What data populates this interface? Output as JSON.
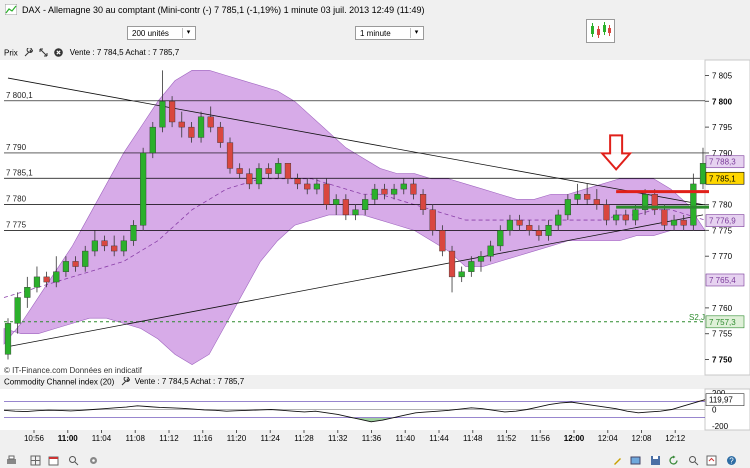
{
  "window": {
    "title": "DAX - Allemagne 30 au comptant (Mini-contr (-)   7 785,1 (-1,19%)    1 minute  03 juil. 2013 12:49 (11:49)"
  },
  "toolbar": {
    "units_select": "200 unités",
    "timeframe_select": "1 minute"
  },
  "price_pane": {
    "label": "Prix",
    "quote": "Vente : 7 784,5 Achat : 7 785,7",
    "footer": "© IT-Finance.com  Données en indicatif",
    "s2_label": "S2,J",
    "left_labels": [
      {
        "text": "7 800,1",
        "price": 7800.1
      },
      {
        "text": "7 790",
        "price": 7790
      },
      {
        "text": "7 785,1",
        "price": 7785.1
      },
      {
        "text": "7 780",
        "price": 7780
      },
      {
        "text": "7 775",
        "price": 7775
      }
    ],
    "axis_ticks": [
      {
        "text": "7 805",
        "value": 7805,
        "bold": false
      },
      {
        "text": "7 800",
        "value": 7800,
        "bold": true
      },
      {
        "text": "7 795",
        "value": 7795,
        "bold": false
      },
      {
        "text": "7 790",
        "value": 7790,
        "bold": false
      },
      {
        "text": "7 780",
        "value": 7780,
        "bold": false
      },
      {
        "text": "7 775",
        "value": 7775,
        "bold": false
      },
      {
        "text": "7 770",
        "value": 7770,
        "bold": false
      },
      {
        "text": "7 760",
        "value": 7760,
        "bold": false
      },
      {
        "text": "7 755",
        "value": 7755,
        "bold": false
      },
      {
        "text": "7 750",
        "value": 7750,
        "bold": true
      }
    ],
    "axis_tags": [
      {
        "text": "7 788,3",
        "value": 7788.3,
        "fill": "#e6d2f0",
        "color": "#7a3a9a"
      },
      {
        "text": "7 785,1",
        "value": 7785.1,
        "fill": "#ffd700",
        "color": "#000000"
      },
      {
        "text": "7 776,9",
        "value": 7776.9,
        "fill": "#e6d2f0",
        "color": "#7a3a9a"
      },
      {
        "text": "7 765,4",
        "value": 7765.4,
        "fill": "#e6d2f0",
        "color": "#7a3a9a"
      },
      {
        "text": "7 757,3",
        "value": 7757.3,
        "fill": "#dff0d8",
        "color": "#2e8b2e"
      }
    ]
  },
  "cci_pane": {
    "label": "Commodity Channel index (20)",
    "quote": "Vente : 7 784,5 Achat : 7 785,7",
    "axis_ticks": [
      {
        "text": "200",
        "value": 200
      },
      {
        "text": "100",
        "value": 100
      },
      {
        "text": "0",
        "value": 0
      },
      {
        "text": "-200",
        "value": -200
      }
    ],
    "current_tag": {
      "text": "119,97",
      "value": 119.97
    }
  },
  "time_axis": [
    {
      "text": "10:56",
      "bold": false
    },
    {
      "text": "11:00",
      "bold": true
    },
    {
      "text": "11:04",
      "bold": false
    },
    {
      "text": "11:08",
      "bold": false
    },
    {
      "text": "11:12",
      "bold": false
    },
    {
      "text": "11:16",
      "bold": false
    },
    {
      "text": "11:20",
      "bold": false
    },
    {
      "text": "11:24",
      "bold": false
    },
    {
      "text": "11:28",
      "bold": false
    },
    {
      "text": "11:32",
      "bold": false
    },
    {
      "text": "11:36",
      "bold": false
    },
    {
      "text": "11:40",
      "bold": false
    },
    {
      "text": "11:44",
      "bold": false
    },
    {
      "text": "11:48",
      "bold": false
    },
    {
      "text": "11:52",
      "bold": false
    },
    {
      "text": "11:56",
      "bold": false
    },
    {
      "text": "12:00",
      "bold": true
    },
    {
      "text": "12:04",
      "bold": false
    },
    {
      "text": "12:08",
      "bold": false
    },
    {
      "text": "12:12",
      "bold": false
    }
  ],
  "colors": {
    "up": "#2bb02b",
    "down": "#d9473f",
    "band": "#c98fe0",
    "support": "#2e8b2e",
    "arrow": "#e0201a"
  },
  "chart_data": [
    {
      "type": "candlestick",
      "title": "DAX - Allemagne 30 au comptant (Mini-contr (-)",
      "interval": "1 minute",
      "ylim": [
        7747,
        7808
      ],
      "series_ohlc": [
        [
          7751,
          7758,
          7750,
          7757
        ],
        [
          7757,
          7763,
          7755,
          7762
        ],
        [
          7762,
          7766,
          7760,
          7764
        ],
        [
          7764,
          7768,
          7763,
          7766
        ],
        [
          7766,
          7767,
          7764,
          7765
        ],
        [
          7765,
          7770,
          7764,
          7767
        ],
        [
          7767,
          7770,
          7766,
          7769
        ],
        [
          7769,
          7770,
          7767,
          7768
        ],
        [
          7768,
          7772,
          7767,
          7771
        ],
        [
          7771,
          7775,
          7770,
          7773
        ],
        [
          7773,
          7774,
          7771,
          7772
        ],
        [
          7772,
          7774,
          7770,
          7771
        ],
        [
          7771,
          7774,
          7770,
          7773
        ],
        [
          7773,
          7777,
          7772,
          7776
        ],
        [
          7776,
          7791,
          7775,
          7790
        ],
        [
          7790,
          7796,
          7789,
          7795
        ],
        [
          7795,
          7806,
          7794,
          7800
        ],
        [
          7800,
          7801,
          7795,
          7796
        ],
        [
          7796,
          7798,
          7793,
          7795
        ],
        [
          7795,
          7796,
          7792,
          7793
        ],
        [
          7793,
          7798,
          7792,
          7797
        ],
        [
          7797,
          7799,
          7794,
          7795
        ],
        [
          7795,
          7796,
          7791,
          7792
        ],
        [
          7792,
          7793,
          7786,
          7787
        ],
        [
          7787,
          7788,
          7785,
          7786
        ],
        [
          7786,
          7787,
          7783,
          7784
        ],
        [
          7784,
          7788,
          7783,
          7787
        ],
        [
          7787,
          7788,
          7785,
          7786
        ],
        [
          7786,
          7789,
          7785,
          7788
        ],
        [
          7788,
          7788,
          7784,
          7785
        ],
        [
          7785,
          7786,
          7783,
          7784
        ],
        [
          7784,
          7785,
          7782,
          7783
        ],
        [
          7783,
          7785,
          7782,
          7784
        ],
        [
          7784,
          7785,
          7779,
          7780
        ],
        [
          7780,
          7782,
          7778,
          7781
        ],
        [
          7781,
          7782,
          7777,
          7778
        ],
        [
          7778,
          7780,
          7777,
          7779
        ],
        [
          7779,
          7782,
          7778,
          7781
        ],
        [
          7781,
          7784,
          7780,
          7783
        ],
        [
          7783,
          7784,
          7781,
          7782
        ],
        [
          7782,
          7784,
          7781,
          7783
        ],
        [
          7783,
          7785,
          7782,
          7784
        ],
        [
          7784,
          7785,
          7781,
          7782
        ],
        [
          7782,
          7783,
          7778,
          7779
        ],
        [
          7779,
          7780,
          7774,
          7775
        ],
        [
          7775,
          7776,
          7770,
          7771
        ],
        [
          7771,
          7772,
          7763,
          7766
        ],
        [
          7766,
          7768,
          7765,
          7767
        ],
        [
          7767,
          7770,
          7766,
          7769
        ],
        [
          7769,
          7771,
          7767,
          7770
        ],
        [
          7770,
          7773,
          7769,
          7772
        ],
        [
          7772,
          7776,
          7771,
          7775
        ],
        [
          7775,
          7778,
          7774,
          7777
        ],
        [
          7777,
          7778,
          7775,
          7776
        ],
        [
          7776,
          7777,
          7774,
          7775
        ],
        [
          7775,
          7776,
          7773,
          7774
        ],
        [
          7774,
          7777,
          7773,
          7776
        ],
        [
          7776,
          7779,
          7775,
          7778
        ],
        [
          7778,
          7782,
          7777,
          7781
        ],
        [
          7781,
          7784,
          7780,
          7782
        ],
        [
          7782,
          7784,
          7780,
          7781
        ],
        [
          7781,
          7783,
          7779,
          7780
        ],
        [
          7780,
          7781,
          7776,
          7777
        ],
        [
          7777,
          7779,
          7776,
          7778
        ],
        [
          7778,
          7779,
          7776,
          7777
        ],
        [
          7777,
          7780,
          7776,
          7779
        ],
        [
          7779,
          7783,
          7778,
          7782
        ],
        [
          7782,
          7783,
          7778,
          7779
        ],
        [
          7779,
          7780,
          7775,
          7776
        ],
        [
          7776,
          7778,
          7775,
          7777
        ],
        [
          7777,
          7778,
          7775,
          7776
        ],
        [
          7776,
          7786,
          7775,
          7784
        ],
        [
          7784,
          7791,
          7783,
          7788
        ]
      ],
      "bollinger": {
        "upper": [
          7753,
          7757,
          7762,
          7767,
          7772,
          7778,
          7784,
          7790,
          7795,
          7800,
          7804,
          7806,
          7806,
          7805,
          7804,
          7803,
          7802,
          7800,
          7797,
          7794,
          7791,
          7789,
          7787,
          7786,
          7786,
          7785,
          7785,
          7784,
          7783,
          7782,
          7781,
          7781,
          7782,
          7782,
          7783,
          7784,
          7785,
          7785,
          7785,
          7783,
          7780,
          7775
        ],
        "lower": [
          7756,
          7755,
          7755,
          7756,
          7757,
          7758,
          7758,
          7757,
          7756,
          7754,
          7751,
          7749,
          7751,
          7757,
          7763,
          7769,
          7773,
          7776,
          7777,
          7778,
          7778,
          7778,
          7777,
          7776,
          7775,
          7773,
          7771,
          7768,
          7768,
          7769,
          7770,
          7771,
          7772,
          7773,
          7773,
          7773,
          7773,
          7774,
          7774,
          7775,
          7775,
          7775
        ],
        "middle": [
          7762,
          7763,
          7764,
          7765,
          7766,
          7767,
          7768,
          7769,
          7771,
          7773,
          7776,
          7779,
          7781,
          7783,
          7784,
          7785,
          7785,
          7785,
          7785,
          7784,
          7783,
          7782,
          7782,
          7781,
          7780,
          7779,
          7778,
          7777,
          7777,
          7777,
          7777,
          7777,
          7777,
          7777,
          7777,
          7777,
          7778,
          7778,
          7779,
          7779,
          7778,
          7777
        ]
      },
      "horizontal_levels": [
        7800.1,
        7790,
        7785.1,
        7780,
        7775
      ],
      "support_level": {
        "label": "S2,J",
        "value": 7757.3
      },
      "trendlines": [
        {
          "from": [
            0,
            7804.5
          ],
          "to": [
            72,
            7780
          ]
        },
        {
          "from": [
            0,
            7752.5
          ],
          "to": [
            72,
            7778
          ]
        }
      ],
      "markers": [
        {
          "type": "arrow-down",
          "at": 63
        },
        {
          "type": "hline",
          "color": "red",
          "from": 63,
          "to": 72,
          "value": 7782.5
        },
        {
          "type": "hline",
          "color": "green",
          "from": 63,
          "to": 72,
          "value": 7779.5
        }
      ]
    },
    {
      "type": "line",
      "title": "Commodity Channel index (20)",
      "ylim": [
        -250,
        250
      ],
      "levels": [
        100,
        0,
        -100
      ],
      "values": [
        -10,
        -20,
        -25,
        -15,
        -8,
        -12,
        -18,
        -10,
        0,
        10,
        20,
        30,
        45,
        35,
        25,
        20,
        15,
        5,
        -5,
        -10,
        -20,
        -15,
        -10,
        -5,
        0,
        -10,
        -20,
        -30,
        -20,
        -40,
        -60,
        -90,
        -120,
        -150,
        -130,
        -100,
        -70,
        -40,
        -30,
        -20,
        -10,
        5,
        20,
        10,
        -10,
        -30,
        -20,
        0,
        30,
        60,
        80,
        90,
        70,
        50,
        30,
        10,
        -20,
        -40,
        -30,
        -20,
        0,
        40,
        80,
        120
      ]
    }
  ]
}
